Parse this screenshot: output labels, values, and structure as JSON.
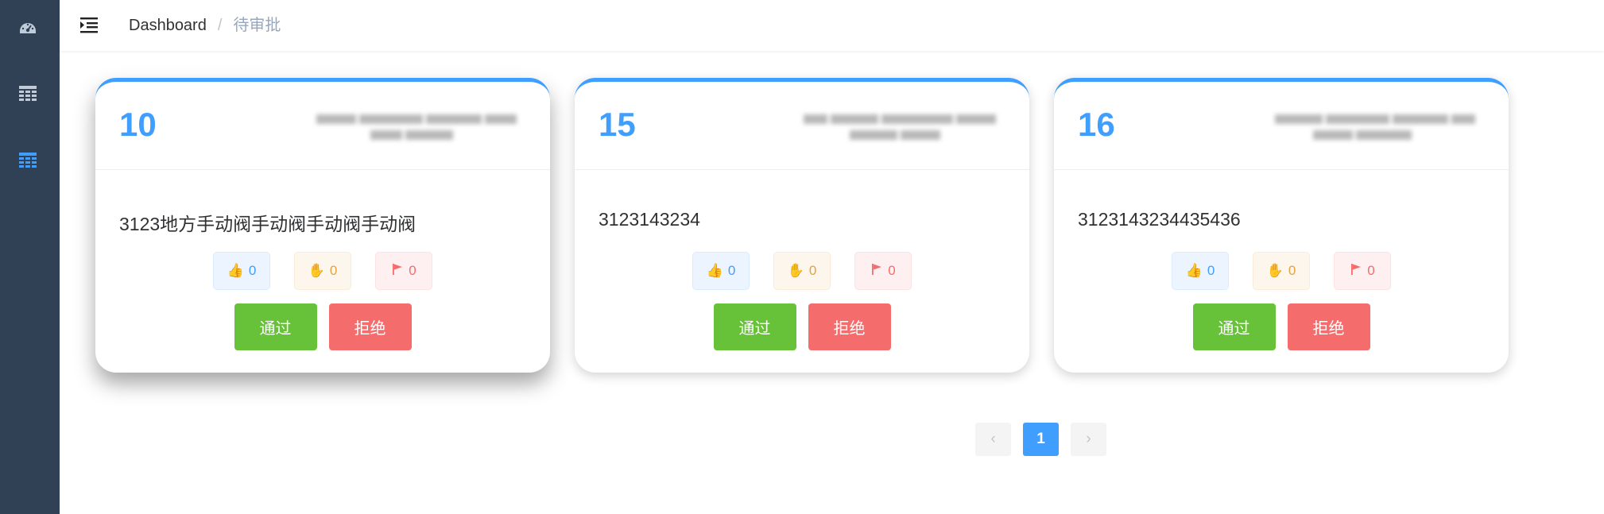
{
  "sidebar": {
    "items": [
      {
        "icon": "dashboard-icon"
      },
      {
        "icon": "table-icon"
      },
      {
        "icon": "table-icon",
        "active": true
      }
    ]
  },
  "navbar": {
    "hamburger_icon": "hamburger-icon",
    "breadcrumb": {
      "home": "Dashboard",
      "separator": "/",
      "current": "待审批"
    }
  },
  "cards": [
    {
      "id": "10",
      "text": "3123地方手动阀手动阀手动阀手动阀",
      "likes": "0",
      "hands": "0",
      "flags": "0",
      "pass_label": "通过",
      "reject_label": "拒绝"
    },
    {
      "id": "15",
      "text": "3123143234",
      "likes": "0",
      "hands": "0",
      "flags": "0",
      "pass_label": "通过",
      "reject_label": "拒绝"
    },
    {
      "id": "16",
      "text": "3123143234435436",
      "likes": "0",
      "hands": "0",
      "flags": "0",
      "pass_label": "通过",
      "reject_label": "拒绝"
    }
  ],
  "pagination": {
    "current": "1"
  },
  "colors": {
    "primary": "#409eff",
    "success": "#67c23a",
    "danger": "#f56c6c",
    "warning": "#e6a23c",
    "sidebar": "#304156"
  }
}
